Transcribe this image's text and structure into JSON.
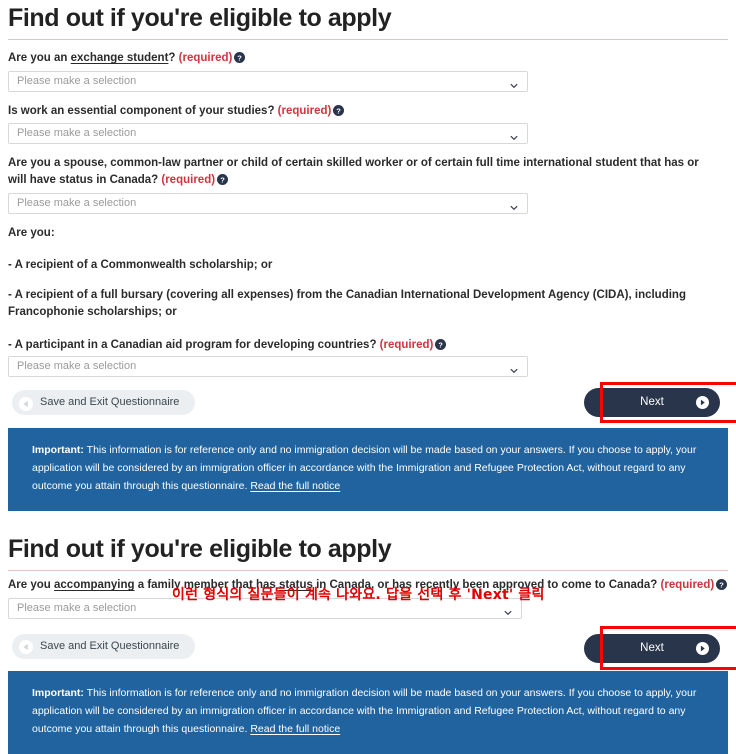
{
  "sections": [
    {
      "title": "Find out if you're eligible to apply",
      "questions": [
        {
          "id": "exchange-student",
          "text_before": "Are you an ",
          "link_text": "exchange student",
          "text_after": "? ",
          "required_label": "(required)",
          "select_value": "Please make a selection"
        },
        {
          "id": "work-essential",
          "text_before": "Is work an essential component of your studies? ",
          "link_text": "",
          "text_after": "",
          "required_label": "(required)",
          "select_value": "Please make a selection"
        },
        {
          "id": "spouse-partner-child",
          "text_before": "Are you a spouse, common-law partner or child of certain skilled worker or of certain full time international student that has or will have status in Canada? ",
          "link_text": "",
          "text_after": "",
          "required_label": "(required)",
          "select_value": "Please make a selection"
        }
      ],
      "are_you_label": "Are you:",
      "bullets": [
        "-  A recipient of a Commonwealth scholarship; or",
        "-  A recipient of a full bursary (covering all expenses) from the Canadian International Development Agency (CIDA), including Francophonie scholarships; or"
      ],
      "final_bullet_question": {
        "id": "canadian-aid-program",
        "text_before": "-  A participant in a Canadian aid program for developing countries? ",
        "required_label": "(required)",
        "select_value": "Please make a selection"
      },
      "buttons": {
        "save_label": "Save and Exit Questionnaire",
        "next_label": "Next"
      },
      "notice": {
        "important_label": "Important:",
        "body": " This information is for reference only and no immigration decision will be made based on your answers. If you choose to apply, your application will be considered by an immigration officer in accordance with the Immigration and Refugee Protection Act, without regard to any outcome you attain through this questionnaire. ",
        "link_label": "Read the full notice"
      }
    },
    {
      "title": "Find out if you're eligible to apply",
      "question": {
        "id": "accompanying-family-member",
        "part1": "Are you ",
        "link1": "accompanying",
        "part2": " a family member that has ",
        "link2": "status",
        "part3": " in Canada, or has recently been approved to come to Canada? ",
        "required_label": "(required)",
        "select_value": "Please make a selection"
      },
      "buttons": {
        "save_label": "Save and Exit Questionnaire",
        "next_label": "Next"
      },
      "notice": {
        "important_label": "Important:",
        "body": " This information is for reference only and no immigration decision will be made based on your answers. If you choose to apply, your application will be considered by an immigration officer in accordance with the Immigration and Refugee Protection Act, without regard to any outcome you attain through this questionnaire. ",
        "link_label": "Read the full notice"
      }
    }
  ],
  "annotation": {
    "korean_text": "이런 형식의 질문들이 계속 나와요. 답을 선택 후 'Next' 클릭"
  },
  "icons": {
    "help": "help-circle-icon",
    "chevron": "chevron-down-icon",
    "prev": "circle-arrow-left-icon",
    "next": "circle-arrow-right-icon"
  },
  "colors": {
    "accent_navy": "#28354a",
    "notice_blue": "#20639f",
    "required_red": "#d3333f",
    "highlight_red": "#f60505",
    "rule_rose": "#e3c4c4"
  }
}
